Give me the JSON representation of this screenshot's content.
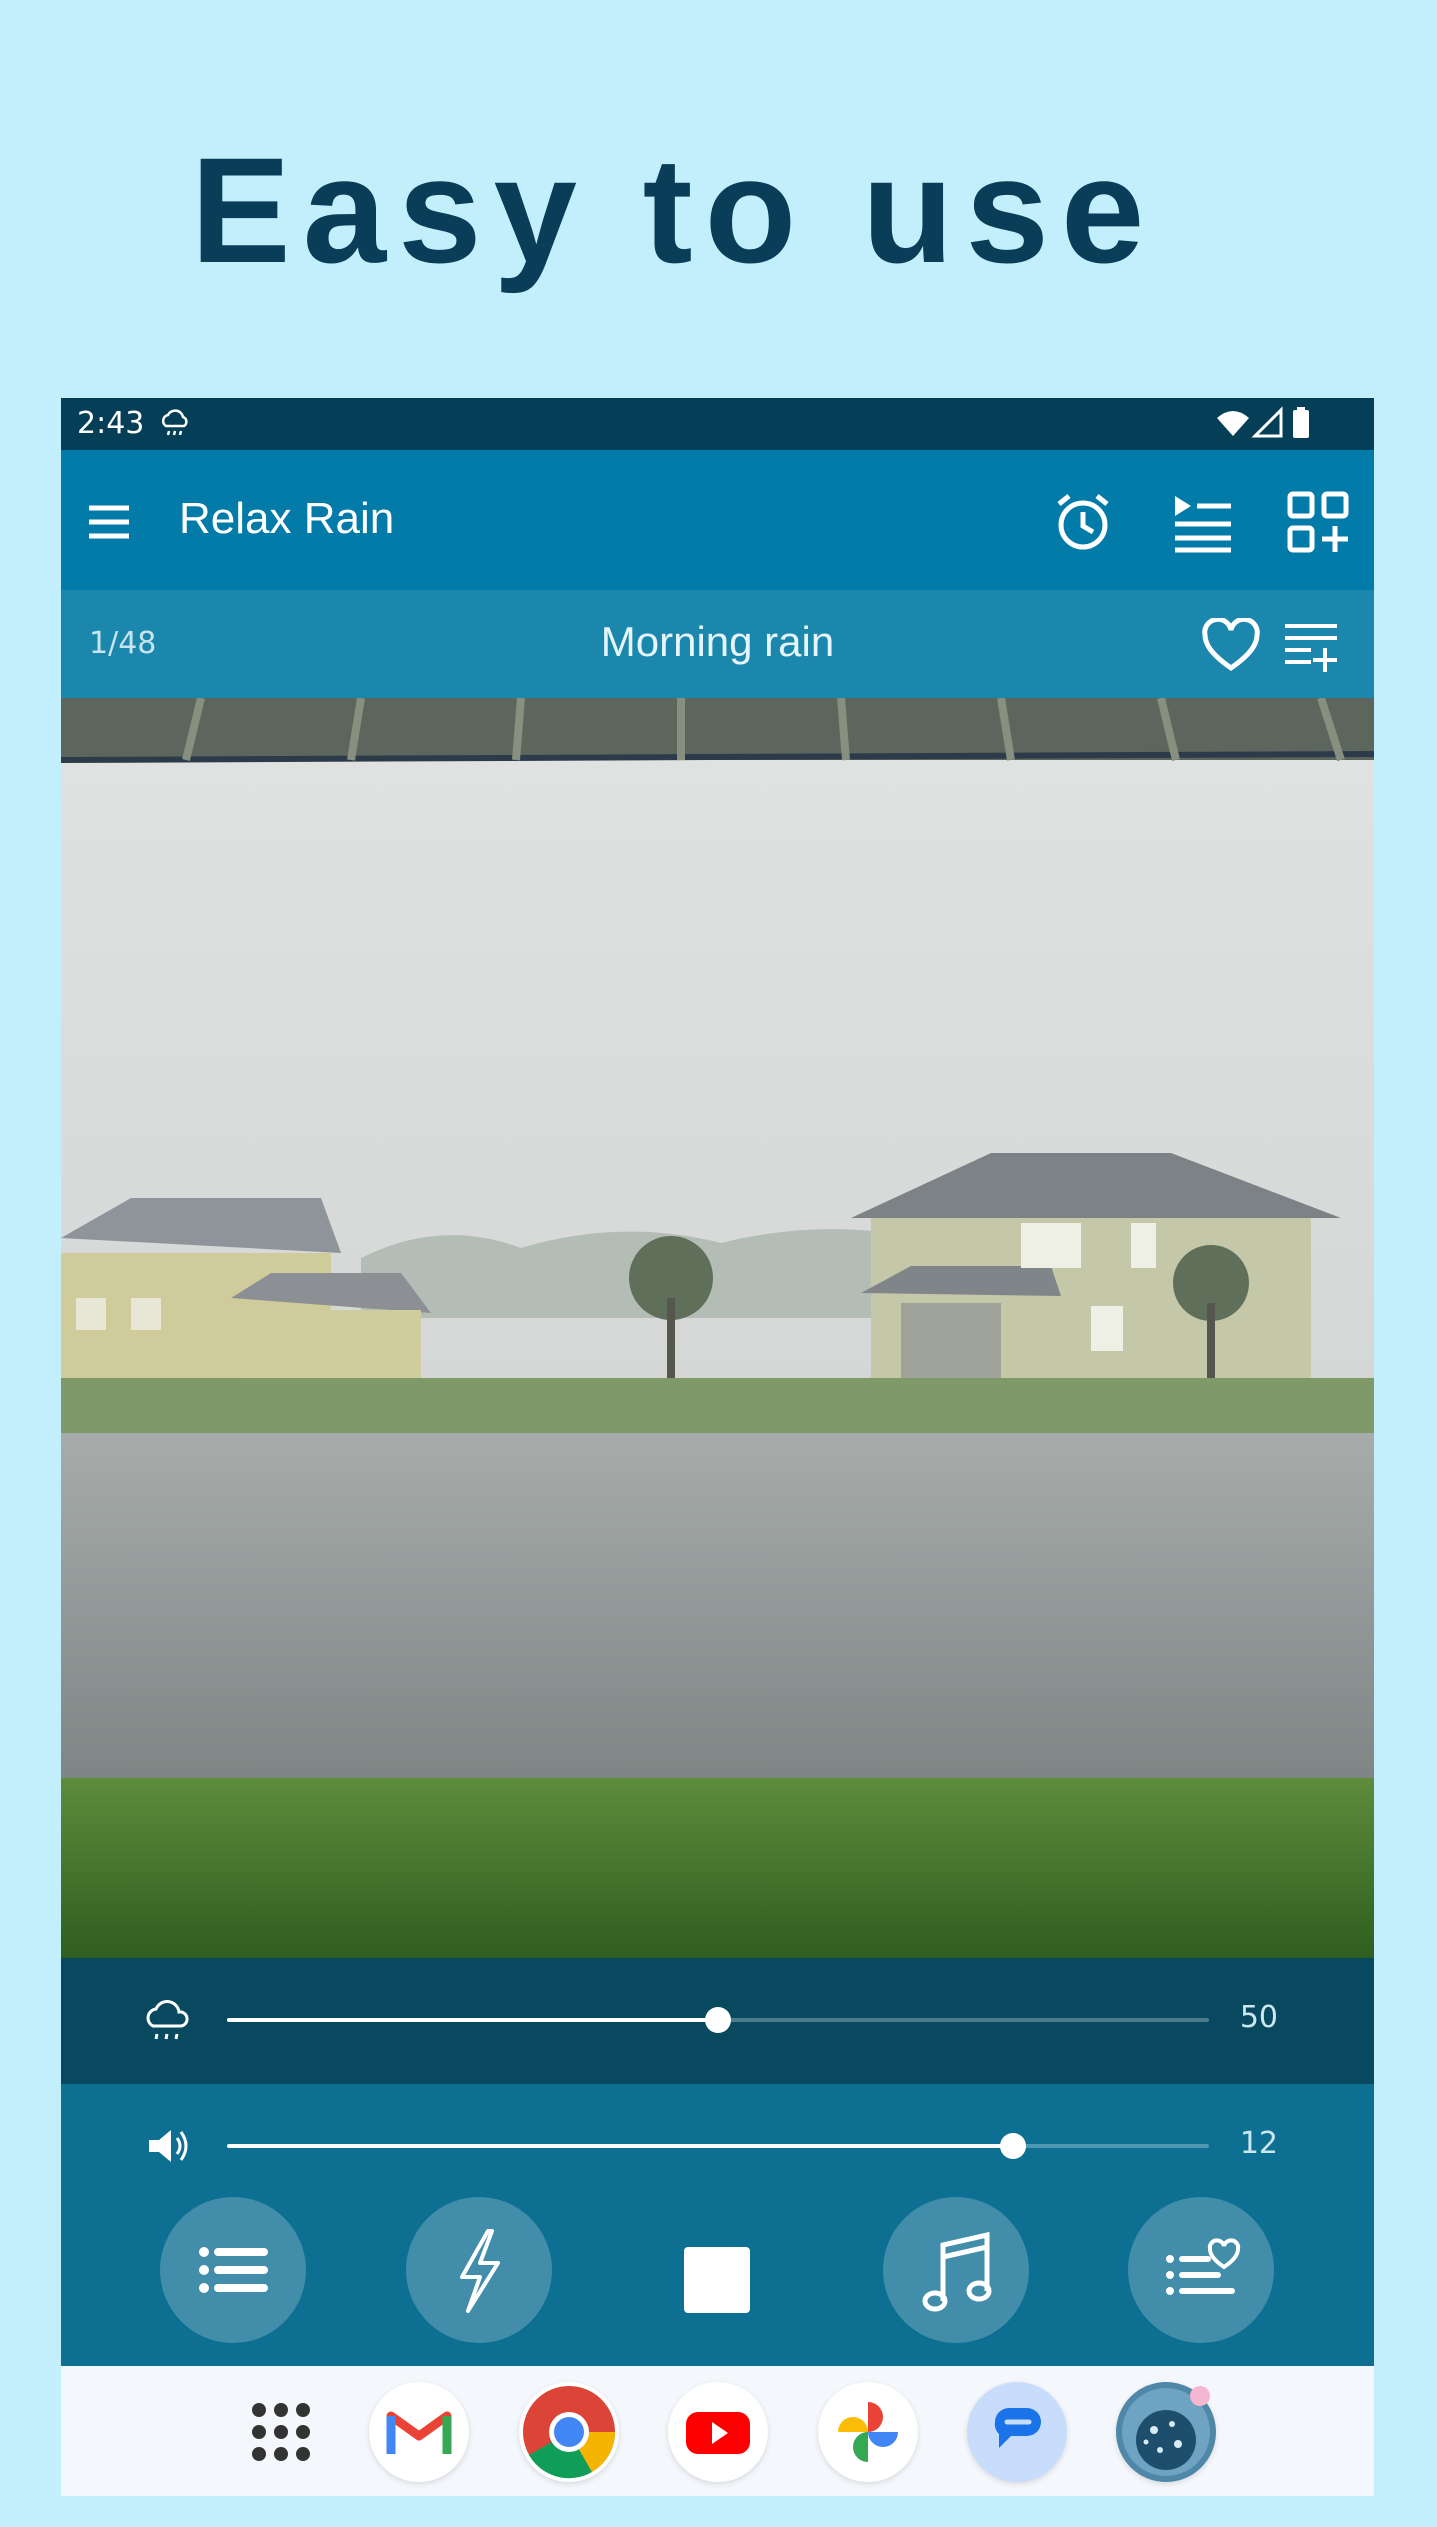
{
  "headline": "Easy to use",
  "status_bar": {
    "time": "2:43",
    "icons": [
      "rain-cloud-icon",
      "wifi-icon",
      "signal-icon",
      "battery-icon"
    ]
  },
  "app_bar": {
    "title": "Relax Rain",
    "icons": [
      "menu-icon",
      "alarm-clock-icon",
      "playlist-play-icon",
      "add-widget-icon"
    ]
  },
  "track": {
    "counter": "1/48",
    "name": "Morning rain",
    "icons": [
      "heart-icon",
      "playlist-add-icon"
    ]
  },
  "rain_slider": {
    "icon": "rain-cloud-icon",
    "value": "50",
    "level_percent": 50
  },
  "volume_slider": {
    "icon": "volume-icon",
    "value": "12",
    "level_percent": 80
  },
  "controls": [
    "list-button",
    "thunder-button",
    "stop-button",
    "music-button",
    "favorites-list-button"
  ],
  "dock": [
    "apps-grid-icon",
    "gmail-icon",
    "chrome-icon",
    "youtube-icon",
    "photos-icon",
    "messages-icon",
    "relax-rain-app-icon"
  ],
  "colors": {
    "background": "#c3effd",
    "headline": "#0a3d57",
    "status_bar": "#053f57",
    "app_bar": "#027ba8",
    "track_bar": "#1b87ad",
    "controls_panel": "#0d6f92"
  }
}
